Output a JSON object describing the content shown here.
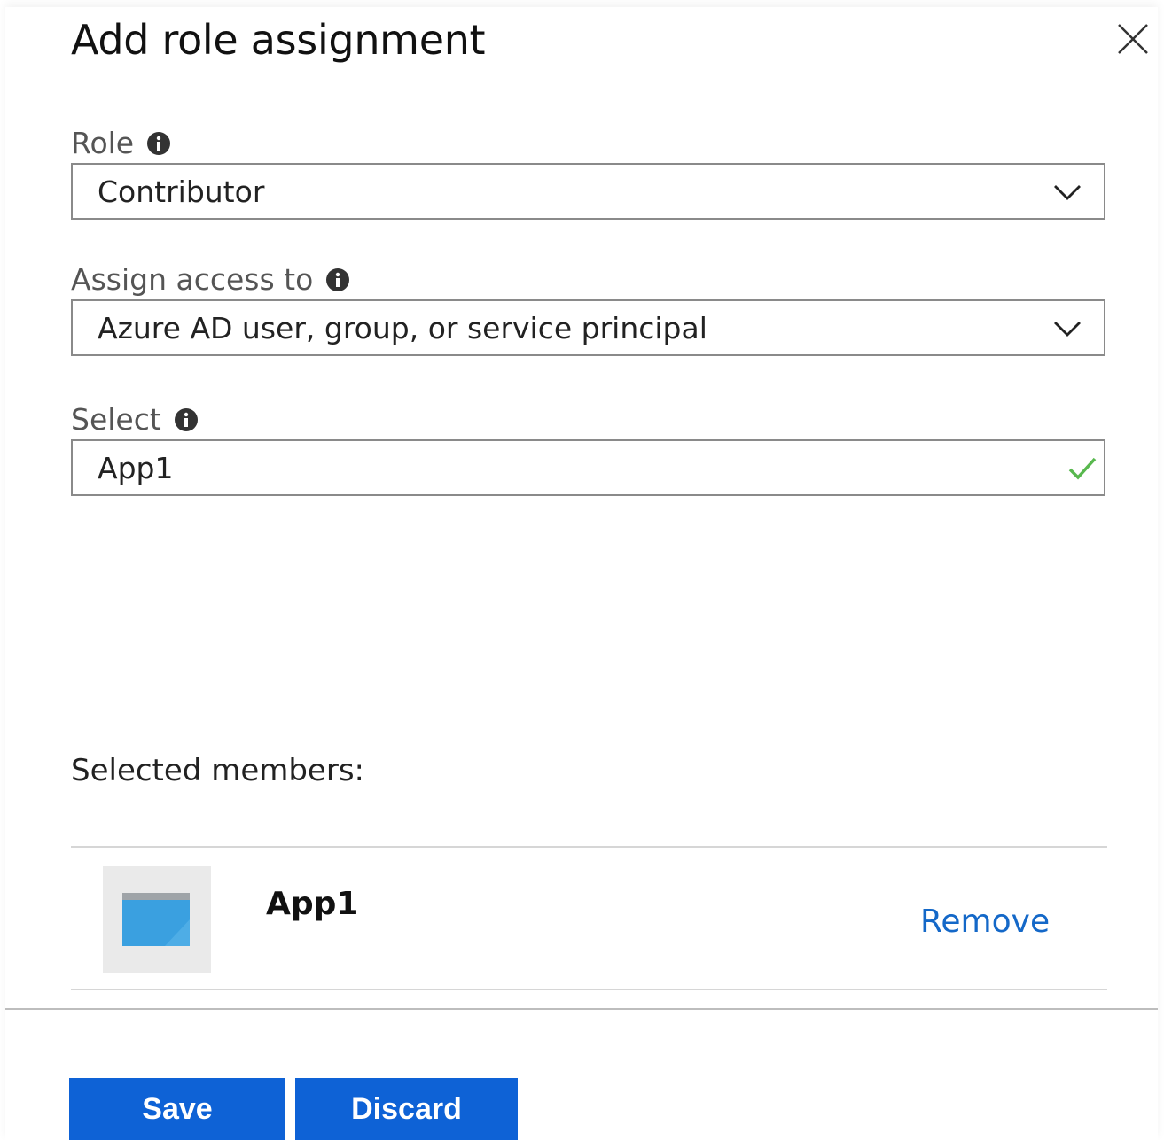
{
  "dialog": {
    "title": "Add role assignment"
  },
  "fields": {
    "role": {
      "label": "Role",
      "value": "Contributor"
    },
    "assign_access_to": {
      "label": "Assign access to",
      "value": "Azure AD user, group, or service principal"
    },
    "select": {
      "label": "Select",
      "value": "App1"
    }
  },
  "selected_members": {
    "label": "Selected members:",
    "items": [
      {
        "name": "App1",
        "action": "Remove",
        "icon": "app-window-icon"
      }
    ]
  },
  "footer": {
    "save_label": "Save",
    "discard_label": "Discard"
  },
  "colors": {
    "primary_button": "#0e62d6",
    "link": "#1468c8",
    "valid_check": "#58b84e"
  }
}
